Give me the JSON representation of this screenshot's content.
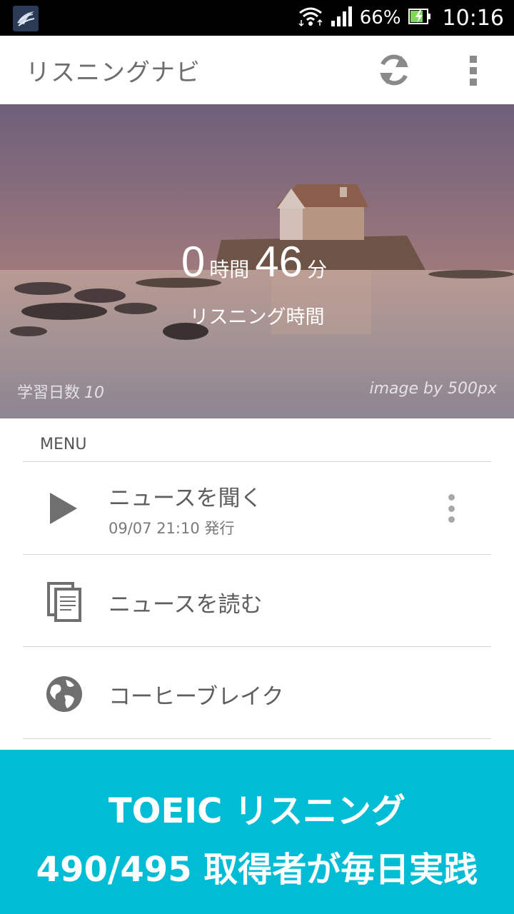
{
  "status_bar": {
    "battery_percent": "66%",
    "time": "10:16",
    "icons": [
      "app-notification-icon",
      "wifi-icon",
      "signal-icon",
      "battery-charging-icon"
    ]
  },
  "app_bar": {
    "title": "リスニングナビ",
    "actions": [
      "refresh-icon",
      "overflow-menu-icon"
    ]
  },
  "hero": {
    "hours": "0",
    "hours_unit": "時間",
    "minutes": "46",
    "minutes_unit": "分",
    "label": "リスニング時間",
    "study_days_label": "学習日数",
    "study_days_value": "10",
    "credit": "image by 500px"
  },
  "menu": {
    "header": "MENU",
    "items": [
      {
        "icon": "play-icon",
        "title": "ニュースを聞く",
        "subtitle": "09/07 21:10 発行",
        "has_more": true
      },
      {
        "icon": "documents-icon",
        "title": "ニュースを読む"
      },
      {
        "icon": "globe-icon",
        "title": "コーヒーブレイク"
      }
    ]
  },
  "banner": {
    "line1": "TOEIC リスニング",
    "line2": "490/495 取得者が毎日実践",
    "background": "#00bcd4"
  }
}
